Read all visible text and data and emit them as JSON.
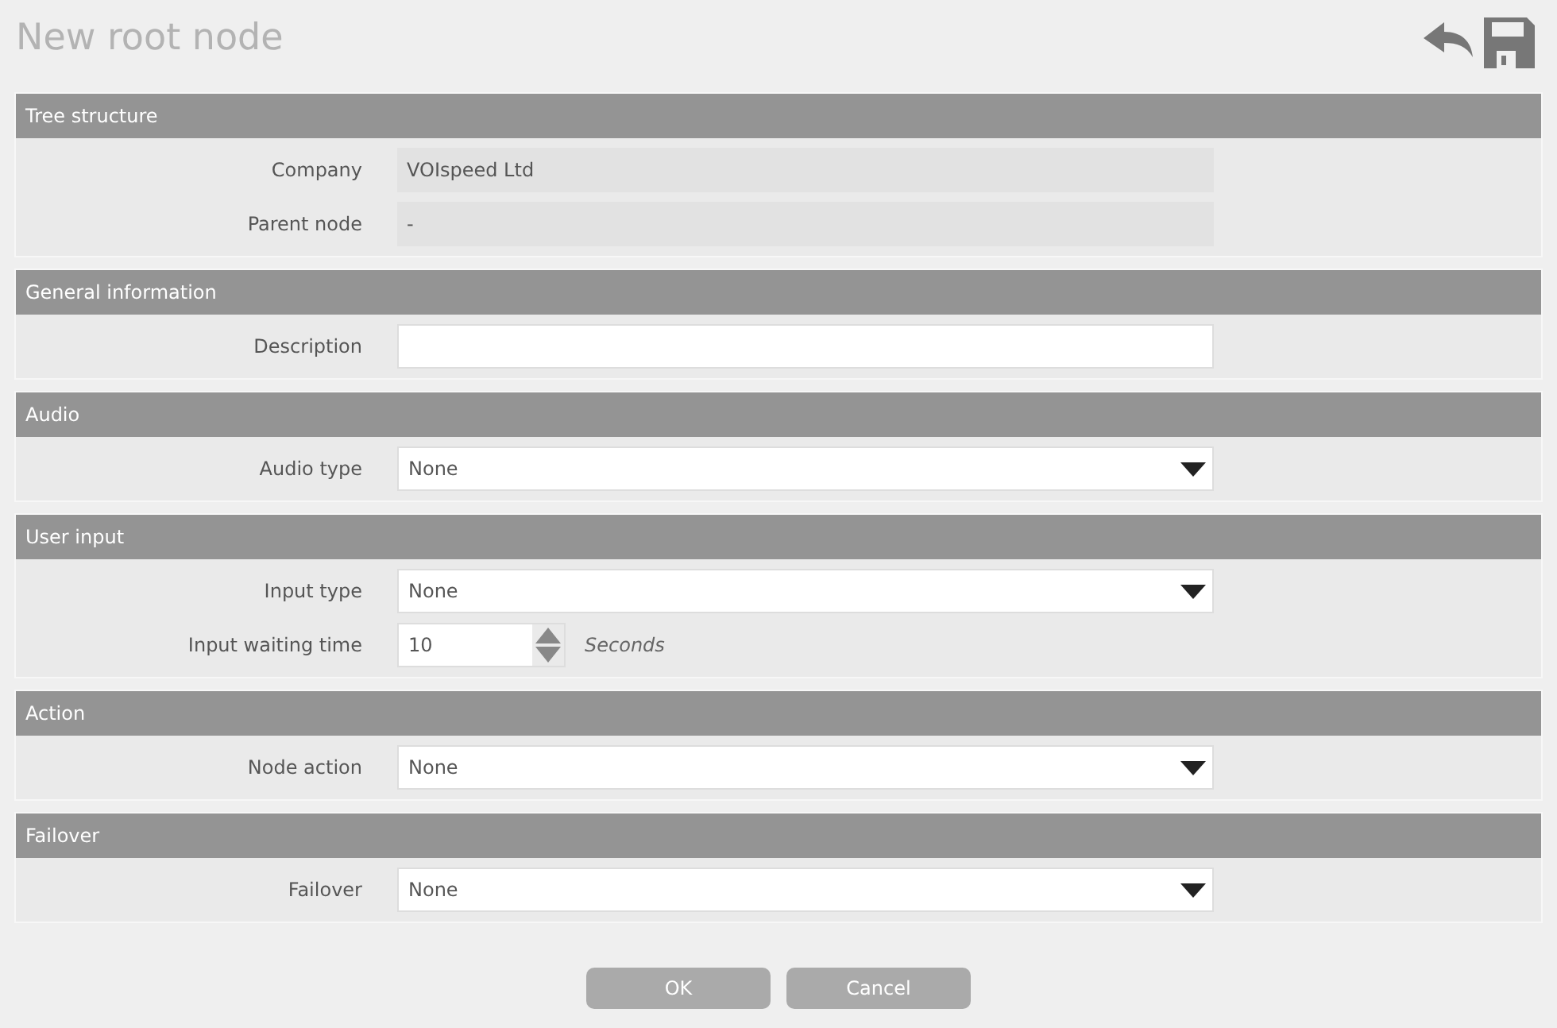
{
  "title": "New root node",
  "sections": [
    {
      "title": "Tree structure",
      "rows": [
        {
          "kind": "readonly",
          "label": "Company",
          "value": "VOIspeed Ltd"
        },
        {
          "kind": "readonly",
          "label": "Parent node",
          "value": "-"
        }
      ]
    },
    {
      "title": "General information",
      "rows": [
        {
          "kind": "text",
          "label": "Description"
        }
      ]
    },
    {
      "title": "Audio",
      "rows": [
        {
          "kind": "select",
          "label": "Audio type",
          "value": "None"
        }
      ]
    },
    {
      "title": "User input",
      "rows": [
        {
          "kind": "select",
          "label": "Input type",
          "value": "None"
        },
        {
          "kind": "spinner",
          "label": "Input waiting time",
          "value": "10",
          "unit": "Seconds"
        }
      ]
    },
    {
      "title": "Action",
      "rows": [
        {
          "kind": "select",
          "label": "Node action",
          "value": "None"
        }
      ]
    },
    {
      "title": "Failover",
      "rows": [
        {
          "kind": "select",
          "label": "Failover",
          "value": "None"
        }
      ]
    }
  ],
  "buttons": [
    "OK",
    "Cancel"
  ]
}
